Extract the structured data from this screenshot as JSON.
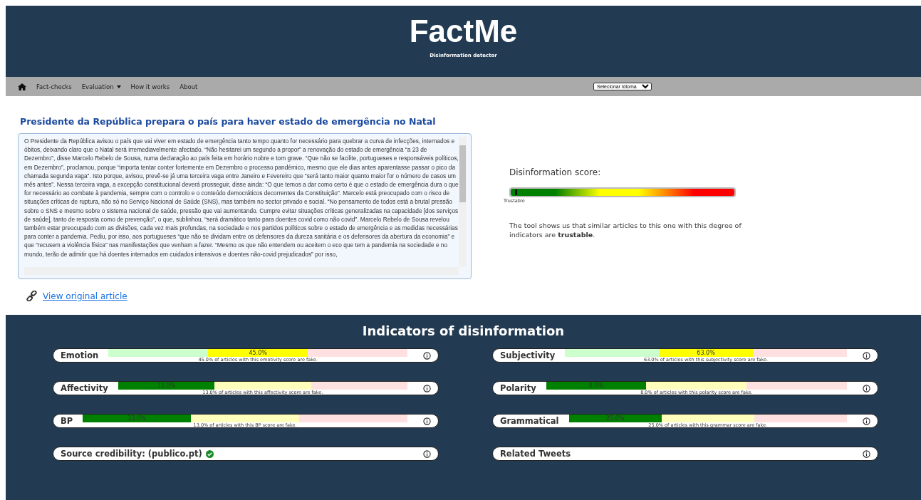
{
  "header": {
    "title": "FactMe",
    "subtitle": "Disinformation detector"
  },
  "nav": {
    "items": [
      {
        "label": "Fact-checks",
        "dropdown": false
      },
      {
        "label": "Evaluation",
        "dropdown": true
      },
      {
        "label": "How it works",
        "dropdown": false
      },
      {
        "label": "About",
        "dropdown": false
      }
    ],
    "language_select": "Selecionar idioma"
  },
  "article": {
    "title": "Presidente da República prepara o país para haver estado de emergência no Natal",
    "text": "O Presidente da República avisou o país que vai viver em estado de emergência tanto tempo quanto for necessário para quebrar a curva de infecções, internados e óbitos, deixando claro que o Natal será irremediavelmente afectado. “Não hesitarei um segundo a propor” a renovação do estado de emergência “a 23 de Dezembro”, disse Marcelo Rebelo de Sousa, numa declaração ao país feita em horário nobre e tom grave. “Que não se facilite, portugueses e responsáveis políticos, em Dezembro”, proclamou, porque “importa tentar conter fortemente em Dezembro o processo pandémico, mesmo que ele dias antes aparentasse passar o pico da chamada segunda vaga”. Isto porque, avisou, prevê-se já uma terceira vaga entre Janeiro e Fevereiro que “será tanto maior quanto maior for o número de casos um mês antes”. Nessa terceira vaga, a excepção constitucional deverá prosseguir, disse ainda: “O que temos a dar como certo é que o estado de emergência dura o que for necessário ao combate à pandemia, sempre com o controlo e o conteúdo democráticos decorrentes da Constituição”. Marcelo está preocupado com o risco de situações críticas de ruptura, não só no Serviço Nacional de Saúde (SNS), mas também no sector privado e social. “No pensamento de todos está a brutal pressão sobre o SNS e mesmo sobre o sistema nacional de saúde, pressão que vai aumentando. Cumpre evitar situações críticas generalizadas na capacidade [dos serviços de saúde], tanto de resposta como de prevenção”, o que, sublinhou, “será dramático tanto para doentes covid como não covid”. Marcelo Rebelo de Sousa revelou também estar preocupado com as divisões, cada vez mais profundas, na sociedade e nos partidos políticos sobre o estado de emergência e as medidas necessárias para conter a pandemia. Pediu, por isso, aos portugueses “que não se dividam entre os defensores da dureza sanitária e os defensores da abertura da economia” e que “recusem a violência física” nas manifestações que venham a fazer. “Mesmo os que não entendem ou aceitem o eco que tem a pandemia na sociedade e no mundo, terão de admitir que há doentes internados em cuidados intensivos e doentes não-covid prejudicados” por isso,",
    "link": "View original article"
  },
  "score": {
    "label": "Disinformation score:",
    "level": 0.02,
    "marker_label": "Trustable",
    "explanation": "The tool shows us that similar articles to this one with this degree of indicators are **trustable**."
  },
  "indicators": {
    "title": "Indicators of disinformation",
    "items": [
      {
        "kind": "bar",
        "label": "Emotion",
        "segments": [
          {
            "active": false
          },
          {
            "active": true
          },
          {
            "active": false
          }
        ],
        "value": "45.0%",
        "caption": "45.0% of articles with this emotivity score are fake."
      },
      {
        "kind": "bar",
        "label": "Subjectivity",
        "segments": [
          {
            "active": false
          },
          {
            "active": true
          },
          {
            "active": false
          }
        ],
        "value": "63.0%",
        "caption": "63.0% of articles with this subjectivity score are fake."
      },
      {
        "kind": "bar",
        "label": "Affectivity",
        "segments": [
          {
            "active": true
          },
          {
            "active": false
          },
          {
            "active": false
          }
        ],
        "value": "13.0%",
        "caption": "13.0% of articles with this affectivity score are fake."
      },
      {
        "kind": "bar",
        "label": "Polarity",
        "segments": [
          {
            "active": true
          },
          {
            "active": false
          },
          {
            "active": false
          }
        ],
        "value": "8.0%",
        "caption": "8.0% of articles with this polarity score are fake."
      },
      {
        "kind": "bar",
        "label": "BP",
        "segments": [
          {
            "active": true
          },
          {
            "active": false
          },
          {
            "active": false
          }
        ],
        "value": "13.0%",
        "caption": "13.0% of articles with this BP score are fake."
      },
      {
        "kind": "bar",
        "label": "Grammatical",
        "segments": [
          {
            "active": true
          },
          {
            "active": false
          },
          {
            "active": false
          }
        ],
        "value": "25.0%",
        "caption": "25.0% of articles with this grammar score are fake."
      },
      {
        "kind": "source",
        "label": "Source credibility: (publico.pt)",
        "verified": true
      },
      {
        "kind": "plain",
        "label": "Related Tweets"
      }
    ]
  }
}
